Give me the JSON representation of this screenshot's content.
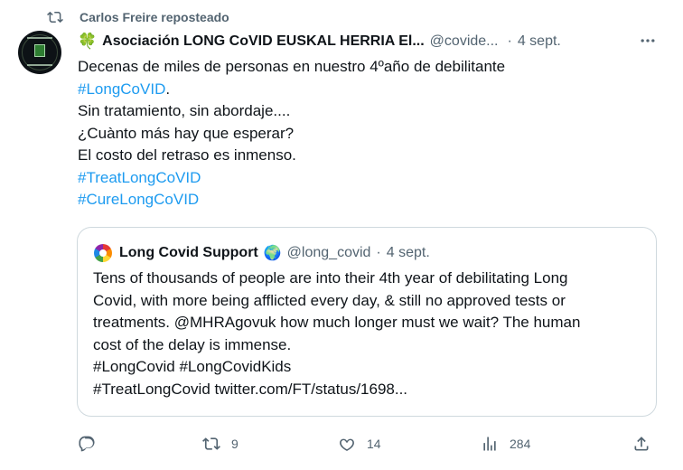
{
  "repost": {
    "text": "Carlos Freire reposteado",
    "icon": "repost-icon"
  },
  "tweet": {
    "clover": "🍀",
    "author_name": "Asociación LONG CoVID EUSKAL HERRIA El...",
    "handle": "@covide...",
    "separator": "·",
    "time": "4 sept.",
    "lines": [
      "Decenas de miles de personas en nuestro 4ºaño de debilitante",
      "#LongCoVID",
      ".",
      "Sin tratamiento, sin abordaje....",
      "¿Cuànto más hay que esperar?",
      "El costo del retraso es inmenso.",
      "#TreatLongCoVID",
      "#CureLongCoVID"
    ]
  },
  "quote": {
    "name": "Long Covid Support",
    "globe": "🌍",
    "handle": "@long_covid",
    "separator": "·",
    "time": "4 sept.",
    "lines": [
      "Tens of thousands of people are into their 4th year of debilitating Long",
      "Covid, with more being afflicted every day, & still no approved tests or",
      "treatments. @MHRAgovuk how much longer must we wait? The human",
      "cost of the delay is immense.",
      "#LongCovid #LongCovidKids",
      "#TreatLongCovid twitter.com/FT/status/1698..."
    ]
  },
  "actions": {
    "reply_count": "",
    "repost_count": "9",
    "like_count": "14",
    "view_count": "284"
  },
  "colors": {
    "link": "#1d9bf0",
    "secondary": "#536471",
    "text": "#0f1419",
    "border": "#cfd9de"
  }
}
